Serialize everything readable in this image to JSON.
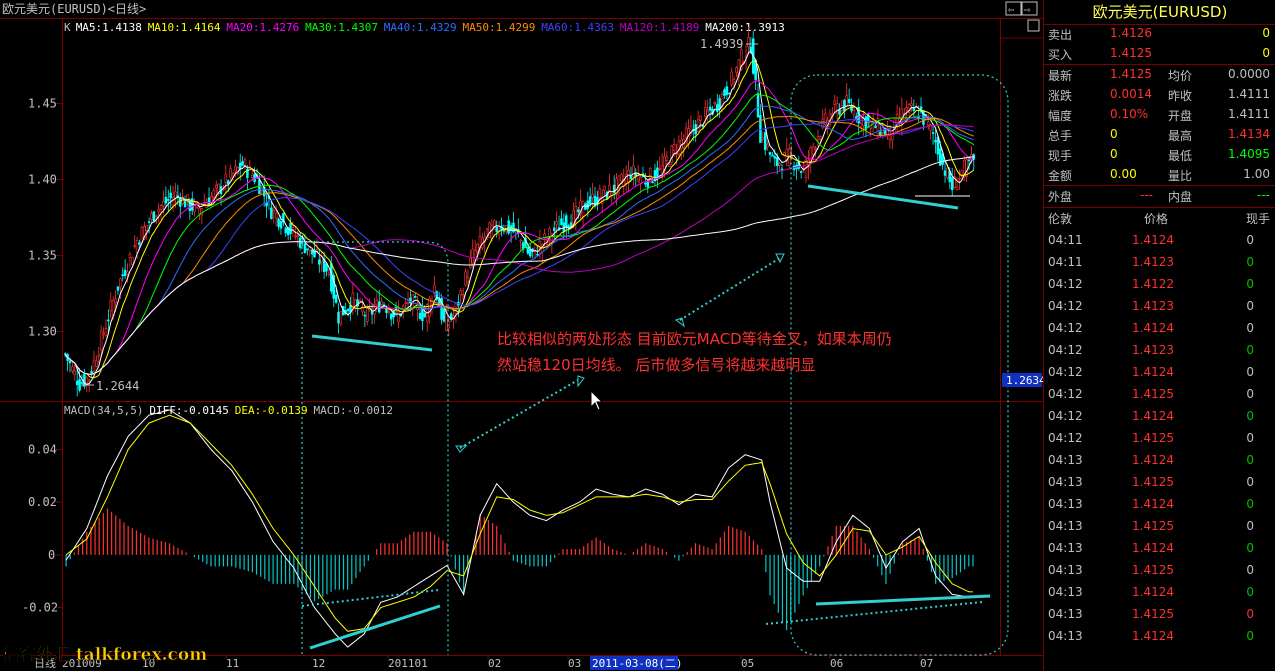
{
  "window": {
    "title": "欧元美元(EURUSD)<日线>"
  },
  "nav_buttons": [
    "⇦",
    "⇨",
    "□"
  ],
  "ma_legend": [
    {
      "label": "K",
      "color": "#c0c0c0"
    },
    {
      "label": "MA5:1.4138",
      "color": "#ffffff"
    },
    {
      "label": "MA10:1.4164",
      "color": "#ffff00"
    },
    {
      "label": "MA20:1.4276",
      "color": "#ff00ff"
    },
    {
      "label": "MA30:1.4307",
      "color": "#00ff00"
    },
    {
      "label": "MA40:1.4329",
      "color": "#2f6bff"
    },
    {
      "label": "MA50:1.4299",
      "color": "#ff8c00"
    },
    {
      "label": "MA60:1.4363",
      "color": "#4040ff"
    },
    {
      "label": "MA120:1.4189",
      "color": "#c000c0"
    },
    {
      "label": "MA200:1.3913",
      "color": "#ffffff"
    }
  ],
  "macd_legend": [
    {
      "label": "MACD(34,5,5)",
      "color": "#c0c0c0"
    },
    {
      "label": "DIFF:-0.0145",
      "color": "#ffffff"
    },
    {
      "label": "DEA:-0.0139",
      "color": "#ffff00"
    },
    {
      "label": "MACD:-0.0012",
      "color": "#c0c0c0"
    }
  ],
  "annotations": {
    "high_label": "1.4939",
    "low_label": "1.2644",
    "price_tag": "1.2634",
    "text_line1": "比较相似的两处形态  目前欧元MACD等待金叉，如果本周仍",
    "text_line2": "然站稳120日均线。 后市做多信号将越来越明显",
    "watermark": "稻客外汇 talkforex.com",
    "date_highlight": "2011-03-08(二)"
  },
  "chart_data": {
    "type": "candlestick",
    "title": "欧元美元(EURUSD)<日线>",
    "price_axis": {
      "ticks": [
        1.3,
        1.35,
        1.4,
        1.45
      ],
      "range": [
        1.255,
        1.505
      ]
    },
    "macd_axis": {
      "ticks": [
        0.04,
        0.02,
        0,
        -0.02
      ],
      "range": [
        -0.038,
        0.058
      ]
    },
    "x_axis_labels": [
      "日线",
      "201009",
      "10",
      "11",
      "12",
      "201101",
      "02",
      "03",
      "05",
      "06",
      "07"
    ],
    "price_anchors": [
      [
        0,
        1.285
      ],
      [
        3,
        1.275
      ],
      [
        6,
        1.266
      ],
      [
        10,
        1.27
      ],
      [
        16,
        1.3
      ],
      [
        22,
        1.33
      ],
      [
        30,
        1.36
      ],
      [
        38,
        1.38
      ],
      [
        46,
        1.39
      ],
      [
        55,
        1.38
      ],
      [
        62,
        1.39
      ],
      [
        68,
        1.4
      ],
      [
        74,
        1.41
      ],
      [
        80,
        1.4
      ],
      [
        86,
        1.38
      ],
      [
        92,
        1.37
      ],
      [
        98,
        1.36
      ],
      [
        104,
        1.35
      ],
      [
        110,
        1.34
      ],
      [
        114,
        1.31
      ],
      [
        120,
        1.32
      ],
      [
        126,
        1.31
      ],
      [
        132,
        1.32
      ],
      [
        138,
        1.31
      ],
      [
        144,
        1.32
      ],
      [
        150,
        1.31
      ],
      [
        154,
        1.33
      ],
      [
        158,
        1.305
      ],
      [
        162,
        1.31
      ],
      [
        166,
        1.33
      ],
      [
        170,
        1.35
      ],
      [
        176,
        1.365
      ],
      [
        182,
        1.37
      ],
      [
        188,
        1.365
      ],
      [
        194,
        1.35
      ],
      [
        200,
        1.36
      ],
      [
        206,
        1.37
      ],
      [
        212,
        1.375
      ],
      [
        218,
        1.385
      ],
      [
        224,
        1.39
      ],
      [
        230,
        1.395
      ],
      [
        236,
        1.405
      ],
      [
        242,
        1.4
      ],
      [
        248,
        1.405
      ],
      [
        254,
        1.42
      ],
      [
        260,
        1.43
      ],
      [
        266,
        1.44
      ],
      [
        272,
        1.45
      ],
      [
        278,
        1.465
      ],
      [
        282,
        1.48
      ],
      [
        286,
        1.49
      ],
      [
        290,
        1.43
      ],
      [
        296,
        1.41
      ],
      [
        302,
        1.415
      ],
      [
        308,
        1.405
      ],
      [
        314,
        1.43
      ],
      [
        320,
        1.445
      ],
      [
        326,
        1.45
      ],
      [
        332,
        1.44
      ],
      [
        338,
        1.435
      ],
      [
        344,
        1.43
      ],
      [
        350,
        1.445
      ],
      [
        356,
        1.445
      ],
      [
        362,
        1.43
      ],
      [
        366,
        1.41
      ],
      [
        370,
        1.395
      ],
      [
        374,
        1.405
      ],
      [
        378,
        1.412
      ]
    ],
    "macd_diff": [
      [
        0,
        -0.002
      ],
      [
        5,
        0.01
      ],
      [
        10,
        0.03
      ],
      [
        15,
        0.045
      ],
      [
        20,
        0.053
      ],
      [
        25,
        0.055
      ],
      [
        30,
        0.05
      ],
      [
        35,
        0.04
      ],
      [
        40,
        0.032
      ],
      [
        45,
        0.02
      ],
      [
        50,
        0.005
      ],
      [
        55,
        -0.005
      ],
      [
        60,
        -0.02
      ],
      [
        65,
        -0.03
      ],
      [
        68,
        -0.035
      ],
      [
        72,
        -0.03
      ],
      [
        76,
        -0.018
      ],
      [
        80,
        -0.016
      ],
      [
        84,
        -0.012
      ],
      [
        88,
        -0.008
      ],
      [
        92,
        -0.004
      ],
      [
        96,
        -0.015
      ],
      [
        100,
        0.015
      ],
      [
        104,
        0.027
      ],
      [
        108,
        0.02
      ],
      [
        112,
        0.015
      ],
      [
        116,
        0.013
      ],
      [
        120,
        0.017
      ],
      [
        124,
        0.02
      ],
      [
        128,
        0.025
      ],
      [
        132,
        0.023
      ],
      [
        136,
        0.022
      ],
      [
        140,
        0.025
      ],
      [
        144,
        0.023
      ],
      [
        148,
        0.019
      ],
      [
        152,
        0.023
      ],
      [
        156,
        0.022
      ],
      [
        160,
        0.033
      ],
      [
        164,
        0.038
      ],
      [
        168,
        0.036
      ],
      [
        170,
        0.02
      ],
      [
        174,
        -0.005
      ],
      [
        178,
        -0.01
      ],
      [
        182,
        -0.01
      ],
      [
        186,
        0.005
      ],
      [
        190,
        0.015
      ],
      [
        194,
        0.01
      ],
      [
        198,
        -0.005
      ],
      [
        202,
        0.005
      ],
      [
        206,
        0.01
      ],
      [
        210,
        -0.008
      ],
      [
        214,
        -0.015
      ],
      [
        218,
        -0.016
      ]
    ],
    "macd_dea": [
      [
        0,
        0
      ],
      [
        5,
        0.006
      ],
      [
        10,
        0.022
      ],
      [
        15,
        0.04
      ],
      [
        20,
        0.05
      ],
      [
        25,
        0.053
      ],
      [
        30,
        0.05
      ],
      [
        35,
        0.042
      ],
      [
        40,
        0.034
      ],
      [
        45,
        0.023
      ],
      [
        50,
        0.01
      ],
      [
        55,
        0.0
      ],
      [
        60,
        -0.012
      ],
      [
        65,
        -0.024
      ],
      [
        68,
        -0.029
      ],
      [
        72,
        -0.028
      ],
      [
        76,
        -0.02
      ],
      [
        80,
        -0.018
      ],
      [
        84,
        -0.016
      ],
      [
        88,
        -0.012
      ],
      [
        92,
        -0.006
      ],
      [
        96,
        -0.008
      ],
      [
        100,
        0.008
      ],
      [
        104,
        0.022
      ],
      [
        108,
        0.021
      ],
      [
        112,
        0.017
      ],
      [
        116,
        0.015
      ],
      [
        120,
        0.016
      ],
      [
        124,
        0.019
      ],
      [
        128,
        0.022
      ],
      [
        132,
        0.022
      ],
      [
        136,
        0.022
      ],
      [
        140,
        0.023
      ],
      [
        144,
        0.022
      ],
      [
        148,
        0.02
      ],
      [
        152,
        0.021
      ],
      [
        156,
        0.021
      ],
      [
        160,
        0.028
      ],
      [
        164,
        0.034
      ],
      [
        168,
        0.035
      ],
      [
        170,
        0.027
      ],
      [
        174,
        0.008
      ],
      [
        178,
        -0.003
      ],
      [
        182,
        -0.008
      ],
      [
        186,
        0.0
      ],
      [
        190,
        0.01
      ],
      [
        194,
        0.009
      ],
      [
        198,
        0.0
      ],
      [
        202,
        0.003
      ],
      [
        206,
        0.007
      ],
      [
        210,
        -0.003
      ],
      [
        214,
        -0.011
      ],
      [
        218,
        -0.014
      ]
    ]
  },
  "side_panel": {
    "title": "欧元美元(EURUSD)",
    "ask": {
      "label": "卖出",
      "price": "1.4126",
      "vol": "0"
    },
    "bid": {
      "label": "买入",
      "price": "1.4125",
      "vol": "0"
    },
    "stats": [
      {
        "l1": "最新",
        "v1": "1.4125",
        "c1": "#ff3030",
        "l2": "均价",
        "v2": "0.0000",
        "c2": "#c0c0c0"
      },
      {
        "l1": "涨跌",
        "v1": "0.0014",
        "c1": "#ff3030",
        "l2": "昨收",
        "v2": "1.4111",
        "c2": "#c0c0c0"
      },
      {
        "l1": "幅度",
        "v1": "0.10%",
        "c1": "#ff3030",
        "l2": "开盘",
        "v2": "1.4111",
        "c2": "#c0c0c0"
      },
      {
        "l1": "总手",
        "v1": "0",
        "c1": "#ffff00",
        "l2": "最高",
        "v2": "1.4134",
        "c2": "#ff3030"
      },
      {
        "l1": "现手",
        "v1": "0",
        "c1": "#ffff00",
        "l2": "最低",
        "v2": "1.4095",
        "c2": "#00ff00"
      },
      {
        "l1": "金额",
        "v1": "0.00",
        "c1": "#ffff00",
        "l2": "量比",
        "v2": "1.00",
        "c2": "#c0c0c0"
      }
    ],
    "outer": {
      "label": "外盘",
      "value": "---"
    },
    "inner": {
      "label": "内盘",
      "value": "---"
    },
    "ticks_header": {
      "time": "伦敦",
      "price": "价格",
      "vol": "现手"
    },
    "ticks": [
      {
        "time": "04:11",
        "price": "1.4124",
        "vol": "0",
        "vc": "#c0c0c0"
      },
      {
        "time": "04:11",
        "price": "1.4123",
        "vol": "0",
        "vc": "#00c000"
      },
      {
        "time": "04:12",
        "price": "1.4122",
        "vol": "0",
        "vc": "#00c000"
      },
      {
        "time": "04:12",
        "price": "1.4123",
        "vol": "0",
        "vc": "#c0c0c0"
      },
      {
        "time": "04:12",
        "price": "1.4124",
        "vol": "0",
        "vc": "#c0c0c0"
      },
      {
        "time": "04:12",
        "price": "1.4123",
        "vol": "0",
        "vc": "#00c000"
      },
      {
        "time": "04:12",
        "price": "1.4124",
        "vol": "0",
        "vc": "#c0c0c0"
      },
      {
        "time": "04:12",
        "price": "1.4125",
        "vol": "0",
        "vc": "#c0c0c0"
      },
      {
        "time": "04:12",
        "price": "1.4124",
        "vol": "0",
        "vc": "#00c000"
      },
      {
        "time": "04:12",
        "price": "1.4125",
        "vol": "0",
        "vc": "#c0c0c0"
      },
      {
        "time": "04:13",
        "price": "1.4124",
        "vol": "0",
        "vc": "#00c000"
      },
      {
        "time": "04:13",
        "price": "1.4125",
        "vol": "0",
        "vc": "#c0c0c0"
      },
      {
        "time": "04:13",
        "price": "1.4124",
        "vol": "0",
        "vc": "#00c000"
      },
      {
        "time": "04:13",
        "price": "1.4125",
        "vol": "0",
        "vc": "#c0c0c0"
      },
      {
        "time": "04:13",
        "price": "1.4124",
        "vol": "0",
        "vc": "#00c000"
      },
      {
        "time": "04:13",
        "price": "1.4125",
        "vol": "0",
        "vc": "#c0c0c0"
      },
      {
        "time": "04:13",
        "price": "1.4124",
        "vol": "0",
        "vc": "#00c000"
      },
      {
        "time": "04:13",
        "price": "1.4125",
        "vol": "0",
        "vc": "#ff3030"
      },
      {
        "time": "04:13",
        "price": "1.4124",
        "vol": "0",
        "vc": "#00c000"
      }
    ]
  }
}
